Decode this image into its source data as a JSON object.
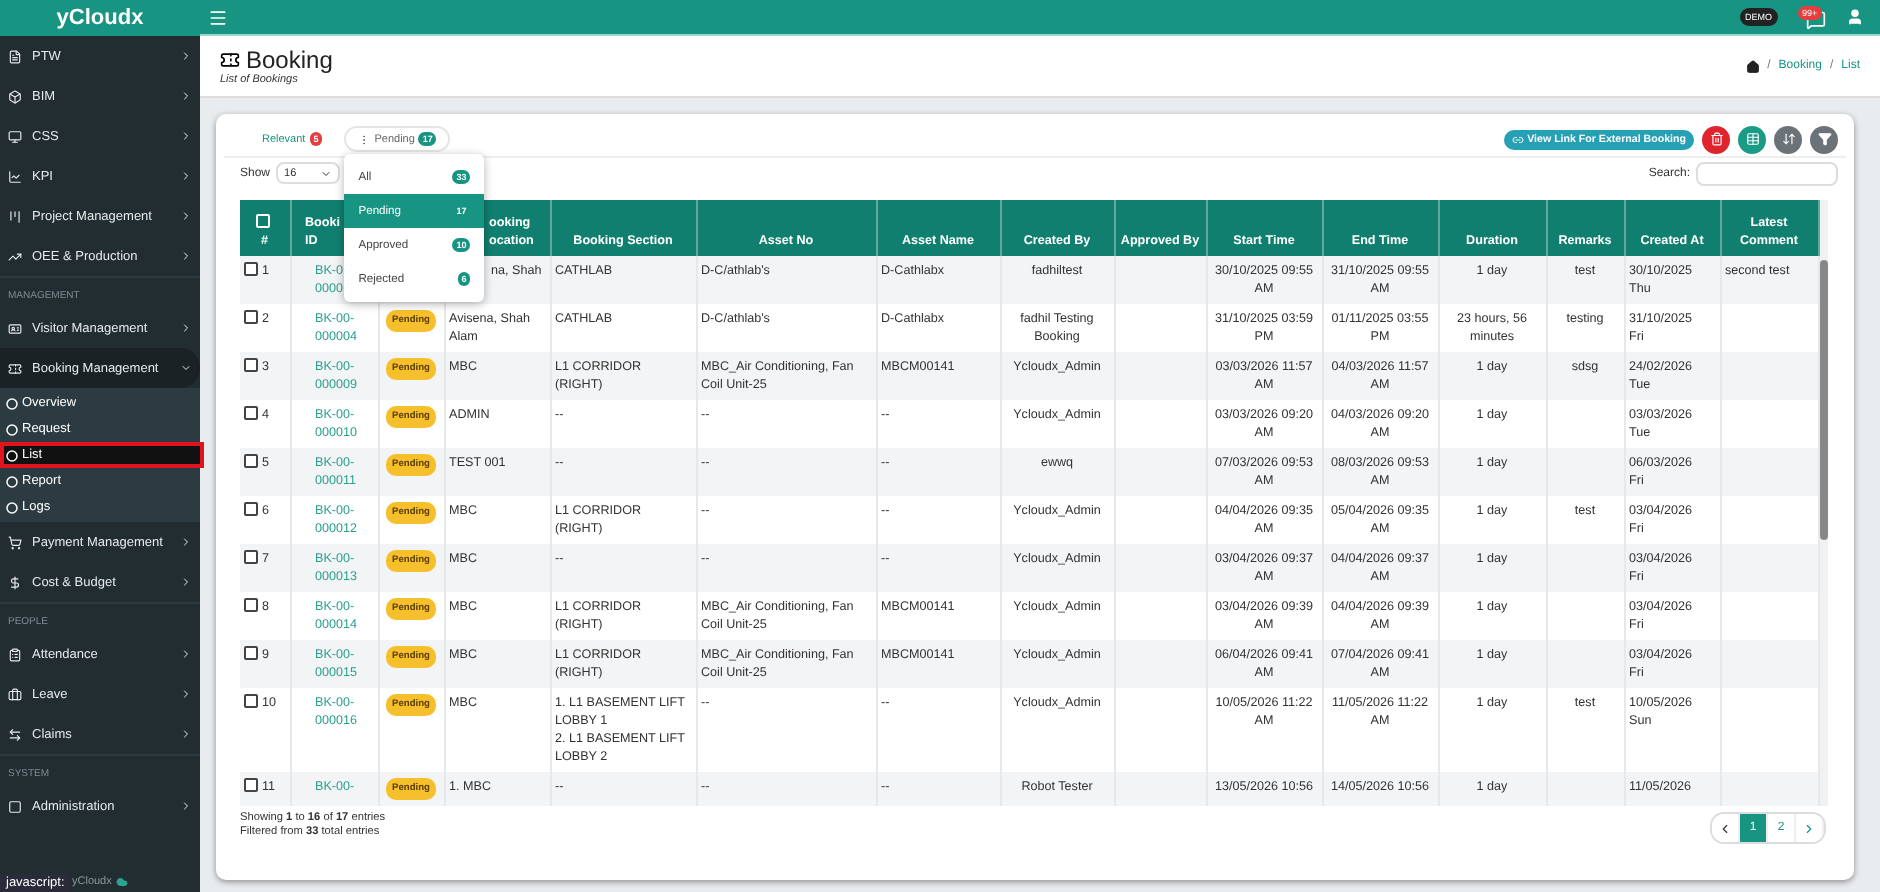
{
  "sidebar": {
    "brand": "yCloudx",
    "groups": [
      {
        "items": [
          {
            "label": "PTW",
            "expanded": false
          },
          {
            "label": "BIM",
            "expanded": false
          },
          {
            "label": "CSS",
            "expanded": false
          },
          {
            "label": "KPI",
            "expanded": false
          },
          {
            "label": "Project Management",
            "expanded": false
          },
          {
            "label": "OEE & Production",
            "expanded": false
          }
        ]
      },
      {
        "heading": "MANAGEMENT",
        "items": [
          {
            "label": "Visitor Management",
            "expanded": false
          },
          {
            "label": "Booking Management",
            "expanded": true,
            "children": [
              {
                "label": "Overview",
                "selected": false
              },
              {
                "label": "Request",
                "selected": false
              },
              {
                "label": "List",
                "selected": true
              },
              {
                "label": "Report",
                "selected": false
              },
              {
                "label": "Logs",
                "selected": false
              }
            ]
          },
          {
            "label": "Payment Management",
            "expanded": false
          },
          {
            "label": "Cost & Budget",
            "expanded": false
          }
        ]
      },
      {
        "heading": "PEOPLE",
        "items": [
          {
            "label": "Attendance",
            "expanded": false
          },
          {
            "label": "Leave",
            "expanded": false
          },
          {
            "label": "Claims",
            "expanded": false
          }
        ]
      },
      {
        "heading": "SYSTEM",
        "items": [
          {
            "label": "Administration",
            "expanded": false
          }
        ]
      }
    ],
    "footer": "yCloudx"
  },
  "status_text": "javascript:",
  "header": {
    "badge": "DEMO",
    "notifications": "99+"
  },
  "page": {
    "title": "Booking",
    "subtitle": "List of Bookings",
    "breadcrumb": [
      {
        "separator": "/",
        "label": "Booking"
      },
      {
        "separator": "/",
        "label": "List"
      }
    ]
  },
  "filter_tabs": [
    {
      "label": "Relevant",
      "count": "5",
      "selected": false
    },
    {
      "label": "Pending",
      "count": "17",
      "selected": true
    }
  ],
  "filter_menu": [
    {
      "label": "All",
      "count": "33",
      "selected": false
    },
    {
      "label": "Pending",
      "count": "17",
      "selected": true
    },
    {
      "label": "Approved",
      "count": "10",
      "selected": false
    },
    {
      "label": "Rejected",
      "count": "6",
      "selected": false
    }
  ],
  "external_link_button": "View Link For External Booking",
  "show": {
    "label": "Show",
    "value": "16"
  },
  "search": {
    "label": "Search:"
  },
  "select_all_checked": false,
  "columns": [
    "#",
    "Booki\nID",
    "ooking\nocation",
    "Booking Section",
    "Asset No",
    "Asset Name",
    "Created By",
    "Approved By",
    "Start Time",
    "End Time",
    "Duration",
    "Remarks",
    "Created At",
    "Latest Comment"
  ],
  "rows": [
    {
      "checked": false,
      "number": "1",
      "id": "BK-0\n0000",
      "location": "na, Shah",
      "section": "CATHLAB",
      "asset_no": "D-C/athlab's",
      "asset_name": "D-Cathlabx",
      "created_by": "fadhiltest",
      "start_time": "30/10/2025 09:55 AM",
      "end_time": "31/10/2025 09:55 AM",
      "duration": "1 day",
      "remarks": "test",
      "created_at": "30/10/2025\nThu",
      "latest_comment": "second test"
    },
    {
      "checked": false,
      "number": "2",
      "id": "BK-00-000004",
      "status": "Pending",
      "location": "Avisena, Shah Alam",
      "section": "CATHLAB",
      "asset_no": "D-C/athlab's",
      "asset_name": "D-Cathlabx",
      "created_by": "fadhil Testing Booking",
      "start_time": "31/10/2025 03:59 PM",
      "end_time": "01/11/2025 03:55 PM",
      "duration": "23 hours, 56 minutes",
      "remarks": "testing",
      "created_at": "31/10/2025\nFri"
    },
    {
      "checked": false,
      "number": "3",
      "id": "BK-00-000009",
      "status": "Pending",
      "location": "MBC",
      "section": "L1 CORRIDOR (RIGHT)",
      "asset_no": "MBC_Air Conditioning, Fan Coil Unit-25",
      "asset_name": "MBCM00141",
      "created_by": "Ycloudx_Admin",
      "start_time": "03/03/2026 11:57 AM",
      "end_time": "04/03/2026 11:57 AM",
      "duration": "1 day",
      "remarks": "sdsg",
      "created_at": "24/02/2026\nTue"
    },
    {
      "checked": false,
      "number": "4",
      "id": "BK-00-000010",
      "status": "Pending",
      "location": "ADMIN",
      "section": "--",
      "asset_no": "--",
      "asset_name": "--",
      "created_by": "Ycloudx_Admin",
      "start_time": "03/03/2026 09:20 AM",
      "end_time": "04/03/2026 09:20 AM",
      "duration": "1 day",
      "created_at": "03/03/2026\nTue"
    },
    {
      "checked": false,
      "number": "5",
      "id": "BK-00-000011",
      "status": "Pending",
      "location": "TEST 001",
      "section": "--",
      "asset_no": "--",
      "asset_name": "--",
      "created_by": "ewwq",
      "start_time": "07/03/2026 09:53 AM",
      "end_time": "08/03/2026 09:53 AM",
      "duration": "1 day",
      "created_at": "06/03/2026\nFri"
    },
    {
      "checked": false,
      "number": "6",
      "id": "BK-00-000012",
      "status": "Pending",
      "location": "MBC",
      "section": "L1 CORRIDOR (RIGHT)",
      "asset_no": "--",
      "asset_name": "--",
      "created_by": "Ycloudx_Admin",
      "start_time": "04/04/2026 09:35 AM",
      "end_time": "05/04/2026 09:35 AM",
      "duration": "1 day",
      "remarks": "test",
      "created_at": "03/04/2026\nFri"
    },
    {
      "checked": false,
      "number": "7",
      "id": "BK-00-000013",
      "status": "Pending",
      "location": "MBC",
      "section": "--",
      "asset_no": "--",
      "asset_name": "--",
      "created_by": "Ycloudx_Admin",
      "start_time": "03/04/2026 09:37 AM",
      "end_time": "04/04/2026 09:37 AM",
      "duration": "1 day",
      "created_at": "03/04/2026\nFri"
    },
    {
      "checked": false,
      "number": "8",
      "id": "BK-00-000014",
      "status": "Pending",
      "location": "MBC",
      "section": "L1 CORRIDOR (RIGHT)",
      "asset_no": "MBC_Air Conditioning, Fan Coil Unit-25",
      "asset_name": "MBCM00141",
      "created_by": "Ycloudx_Admin",
      "start_time": "03/04/2026 09:39 AM",
      "end_time": "04/04/2026 09:39 AM",
      "duration": "1 day",
      "created_at": "03/04/2026\nFri"
    },
    {
      "checked": false,
      "number": "9",
      "id": "BK-00-000015",
      "status": "Pending",
      "location": "MBC",
      "section": "L1 CORRIDOR (RIGHT)",
      "asset_no": "MBC_Air Conditioning, Fan Coil Unit-25",
      "asset_name": "MBCM00141",
      "created_by": "Ycloudx_Admin",
      "start_time": "06/04/2026 09:41 AM",
      "end_time": "07/04/2026 09:41 AM",
      "duration": "1 day",
      "created_at": "03/04/2026\nFri"
    },
    {
      "checked": false,
      "number": "10",
      "id": "BK-00-000016",
      "status": "Pending",
      "location": "MBC",
      "section": "1. L1 BASEMENT LIFT LOBBY 1\n2. L1 BASEMENT LIFT LOBBY 2",
      "asset_no": "--",
      "asset_name": "--",
      "created_by": "Ycloudx_Admin",
      "start_time": "10/05/2026 11:22 AM",
      "end_time": "11/05/2026 11:22 AM",
      "duration": "1 day",
      "remarks": "test",
      "created_at": "10/05/2026\nSun"
    },
    {
      "checked": false,
      "number": "11",
      "id": "BK-00-",
      "status": "Pending",
      "location": "1. MBC",
      "section": "--",
      "asset_no": "--",
      "asset_name": "--",
      "created_by": "Robot Tester",
      "start_time": "13/05/2026 10:56",
      "end_time": "14/05/2026 10:56",
      "duration": "1 day",
      "created_at": "11/05/2026"
    }
  ],
  "summary": [
    "Showing **1** to **16** of **17** entries",
    "Filtered from **33** total entries"
  ],
  "pagination": [
    {
      "label": "1",
      "selected": true
    },
    {
      "label": "2",
      "selected": false
    }
  ]
}
